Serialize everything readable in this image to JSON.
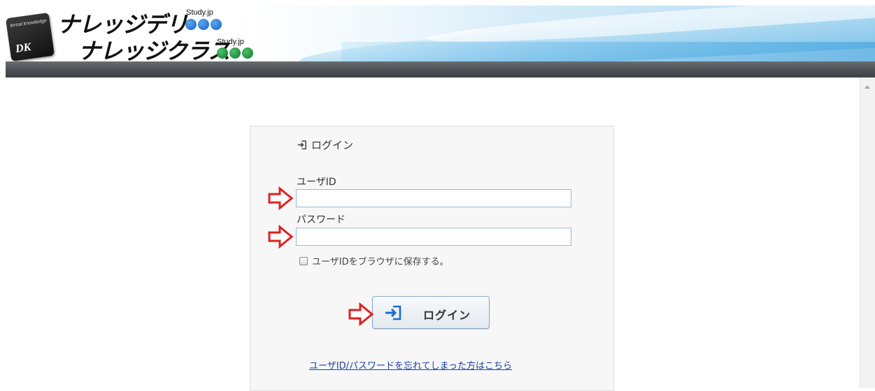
{
  "header": {
    "brand_primary": "ナレッジデリ",
    "brand_secondary": "ナレッジクラス",
    "study_tag_1": "Study.jp",
    "study_tag_2": "Study.jp",
    "logo_small_text": "ternal knowledge",
    "logo_mark": "DK"
  },
  "login": {
    "title": "ログイン",
    "user_label": "ユーザID",
    "user_value": "",
    "password_label": "パスワード",
    "password_value": "",
    "remember_label": "ユーザIDをブラウザに保存する。",
    "remember_checked": false,
    "button_label": "ログイン",
    "forgot_link": "ユーザID/パスワードを忘れてしまった方はこちら"
  },
  "icons": {
    "title_icon": "sign-in-icon",
    "button_icon": "sign-in-icon",
    "annotation_arrows": "red-arrow-icon"
  },
  "colors": {
    "link": "#1a3fa8",
    "annotation_arrow": "#e02020",
    "header_bar": "#4b4e52",
    "login_icon": "#1a6fd0"
  }
}
